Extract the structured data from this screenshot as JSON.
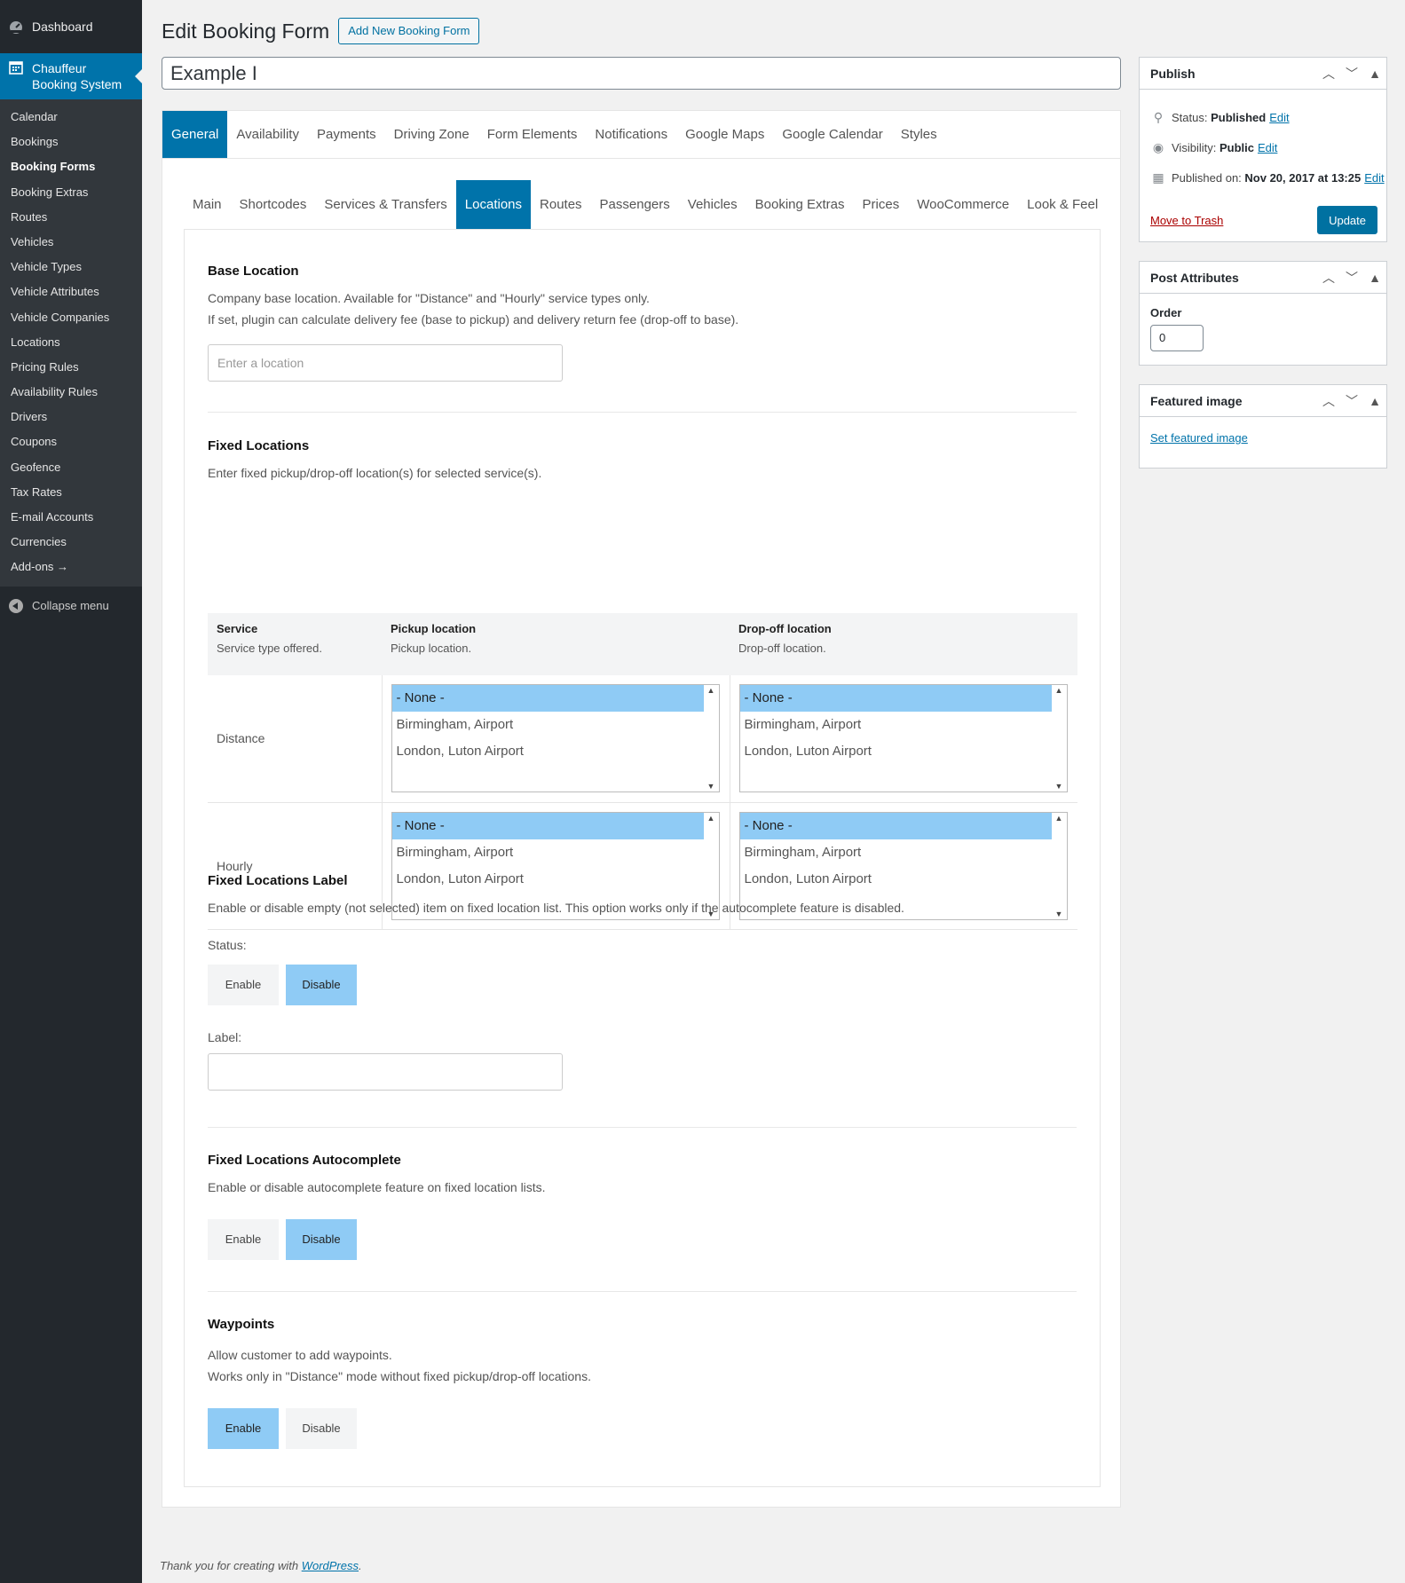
{
  "sidebar": {
    "dashboard": "Dashboard",
    "plugin_title": "Chauffeur Booking System",
    "items": [
      {
        "label": "Calendar"
      },
      {
        "label": "Bookings"
      },
      {
        "label": "Booking Forms"
      },
      {
        "label": "Booking Extras"
      },
      {
        "label": "Routes"
      },
      {
        "label": "Vehicles"
      },
      {
        "label": "Vehicle Types"
      },
      {
        "label": "Vehicle Attributes"
      },
      {
        "label": "Vehicle Companies"
      },
      {
        "label": "Locations"
      },
      {
        "label": "Pricing Rules"
      },
      {
        "label": "Availability Rules"
      },
      {
        "label": "Drivers"
      },
      {
        "label": "Coupons"
      },
      {
        "label": "Geofence"
      },
      {
        "label": "Tax Rates"
      },
      {
        "label": "E-mail Accounts"
      },
      {
        "label": "Currencies"
      },
      {
        "label": "Add-ons →"
      }
    ],
    "current": "Booking Forms",
    "collapse": "Collapse menu"
  },
  "header": {
    "title": "Edit Booking Form",
    "add_new": "Add New Booking Form",
    "post_title": "Example I"
  },
  "tabs": {
    "main": [
      "General",
      "Availability",
      "Payments",
      "Driving Zone",
      "Form Elements",
      "Notifications",
      "Google Maps",
      "Google Calendar",
      "Styles"
    ],
    "main_active": "General",
    "sub": [
      "Main",
      "Shortcodes",
      "Services & Transfers",
      "Locations",
      "Routes",
      "Passengers",
      "Vehicles",
      "Booking Extras",
      "Prices",
      "WooCommerce",
      "Look & Feel"
    ],
    "sub_active": "Locations"
  },
  "base_location": {
    "title": "Base Location",
    "desc1": "Company base location. Available for \"Distance\" and \"Hourly\" service types only.",
    "desc2": "If set, plugin can calculate delivery fee (base to pickup) and delivery return fee (drop-off to base).",
    "placeholder": "Enter a location"
  },
  "fixed_locations": {
    "title": "Fixed Locations",
    "desc": "Enter fixed pickup/drop-off location(s) for selected service(s).",
    "columns": [
      {
        "title": "Service",
        "sub": "Service type offered."
      },
      {
        "title": "Pickup location",
        "sub": "Pickup location."
      },
      {
        "title": "Drop-off location",
        "sub": "Drop-off location."
      }
    ],
    "rows": [
      {
        "service": "Distance"
      },
      {
        "service": "Hourly"
      }
    ],
    "options": [
      "- None -",
      "Birmingham, Airport",
      "London, Luton Airport"
    ]
  },
  "fixed_label": {
    "title": "Fixed Locations Label",
    "desc": "Enable or disable empty (not selected) item on fixed location list. This option works only if the autocomplete feature is disabled.",
    "status_label": "Status:",
    "enable": "Enable",
    "disable": "Disable",
    "selected": "Disable",
    "label_label": "Label:",
    "label_value": ""
  },
  "autocomplete": {
    "title": "Fixed Locations Autocomplete",
    "desc": "Enable or disable autocomplete feature on fixed location lists.",
    "enable": "Enable",
    "disable": "Disable",
    "selected": "Disable"
  },
  "waypoints": {
    "title": "Waypoints",
    "desc1": "Allow customer to add waypoints.",
    "desc2": "Works only in \"Distance\" mode without fixed pickup/drop-off locations.",
    "enable": "Enable",
    "disable": "Disable",
    "selected": "Enable"
  },
  "publish": {
    "title": "Publish",
    "status_label": "Status:",
    "status_value": "Published",
    "visibility_label": "Visibility:",
    "visibility_value": "Public",
    "published_label": "Published on:",
    "published_value": "Nov 20, 2017 at 13:25",
    "edit": "Edit",
    "trash": "Move to Trash",
    "update": "Update"
  },
  "post_attributes": {
    "title": "Post Attributes",
    "order_label": "Order",
    "order_value": "0"
  },
  "featured_image": {
    "title": "Featured image",
    "link": "Set featured image"
  },
  "footer": {
    "text": "Thank you for creating with",
    "link": "WordPress",
    "period": "."
  },
  "colors": {
    "sidebar_bg": "#23282d",
    "accent": "#0073aa",
    "selected_option": "#8fcbf5"
  }
}
